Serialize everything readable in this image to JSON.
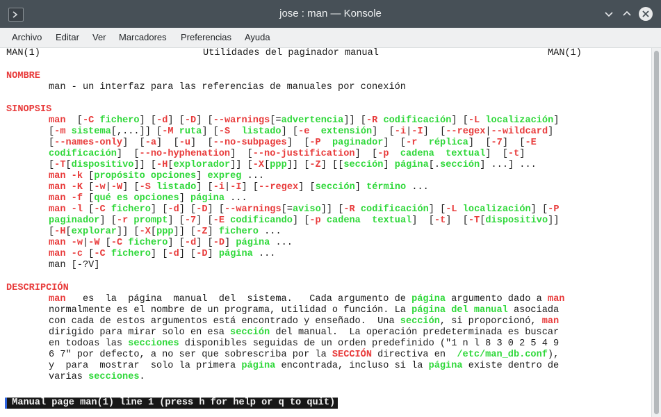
{
  "window": {
    "title": "jose : man — Konsole"
  },
  "menu": [
    "Archivo",
    "Editar",
    "Ver",
    "Marcadores",
    "Preferencias",
    "Ayuda"
  ],
  "header": {
    "left": "MAN(1)",
    "center": "Utilidades del paginador manual",
    "right": "MAN(1)"
  },
  "sections": {
    "nombre": "NOMBRE",
    "nombre_text": "man - un interfaz para las referencias de manuales por conexión",
    "sinopsis": "SINOPSIS",
    "descripcion": "DESCRIPCIÓN"
  },
  "statusbar": "Manual page man(1) line 1 (press h for help or q to quit)",
  "colors": {
    "titlebar": "#475057",
    "section": "#e83b3b",
    "option": "#e83b3b",
    "argument": "#2fd83a",
    "status_bg": "#171717"
  }
}
